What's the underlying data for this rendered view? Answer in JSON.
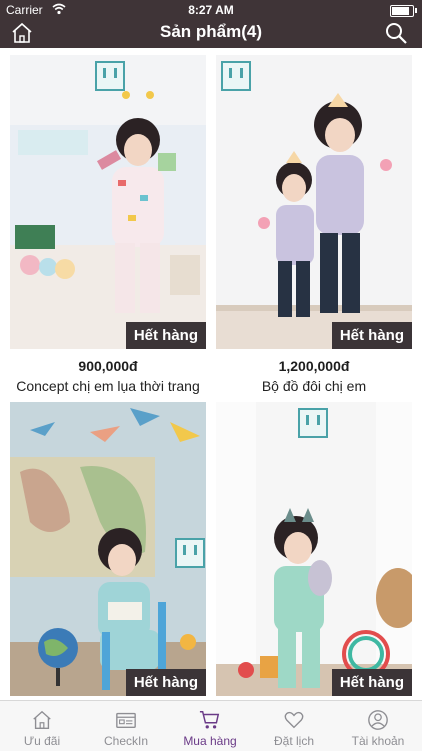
{
  "status_bar": {
    "carrier": "Carrier",
    "time": "8:27 AM",
    "battery_level": 0.95
  },
  "nav": {
    "title": "Sản phẩm(4)"
  },
  "colors": {
    "header_bg": "#3f3437",
    "tab_active": "#6a3a87",
    "tab_inactive": "#8e8e93",
    "badge_bg": "#3b3437"
  },
  "products": [
    {
      "price": "900,000đ",
      "name": "Concept chị em lụa thời trang",
      "badge": "Hết hàng"
    },
    {
      "price": "1,200,000đ",
      "name": "Bộ đồ đôi chị em",
      "badge": "Hết hàng"
    },
    {
      "price": "",
      "name": "",
      "badge": "Hết hàng"
    },
    {
      "price": "",
      "name": "",
      "badge": "Hết hàng"
    }
  ],
  "tabbar": {
    "items": [
      {
        "label": "Ưu đãi",
        "icon": "home-icon"
      },
      {
        "label": "CheckIn",
        "icon": "checkin-icon"
      },
      {
        "label": "Mua hàng",
        "icon": "cart-icon",
        "active": true
      },
      {
        "label": "Đặt lịch",
        "icon": "heart-icon"
      },
      {
        "label": "Tài khoản",
        "icon": "account-icon"
      }
    ]
  }
}
